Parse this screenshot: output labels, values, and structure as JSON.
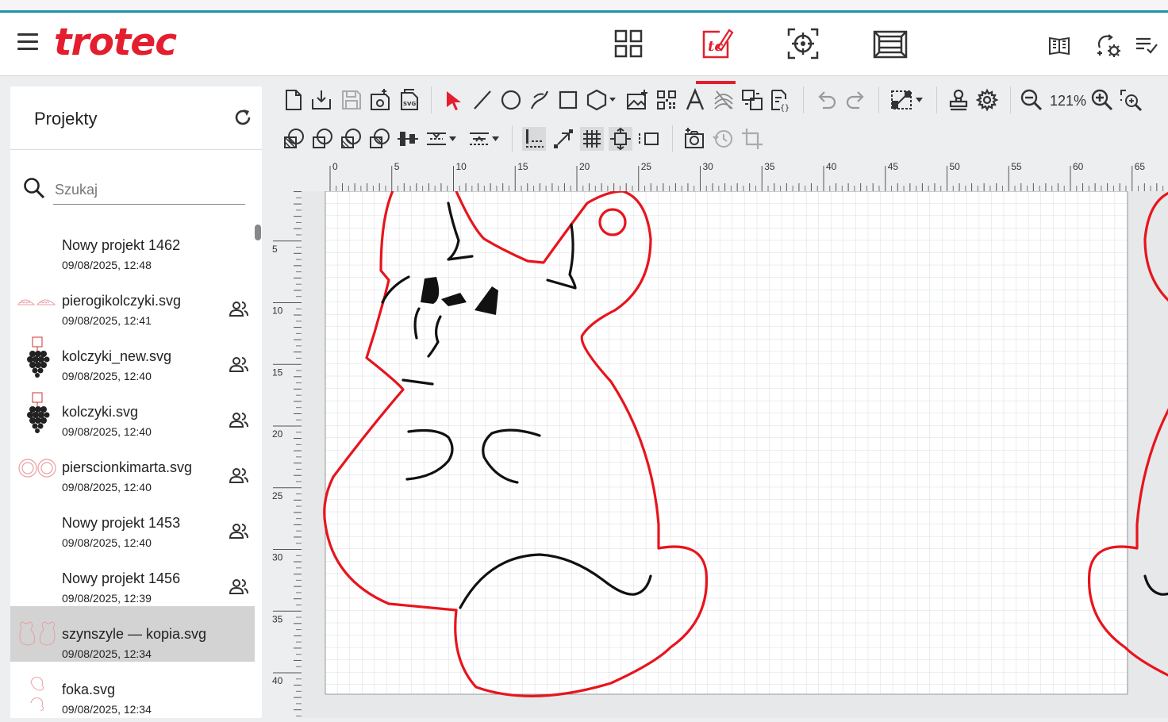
{
  "header": {
    "logo": "trotec",
    "nav": [
      {
        "name": "dashboard",
        "icon": "grid-icon"
      },
      {
        "name": "design",
        "icon": "design-pen-icon",
        "active": true
      },
      {
        "name": "prepare",
        "icon": "crosshair-icon"
      },
      {
        "name": "job",
        "icon": "machine-icon"
      }
    ],
    "right_icons": [
      "book-icon",
      "sync-settings-icon",
      "queue-list-icon"
    ]
  },
  "sidebar": {
    "title": "Projekty",
    "search_placeholder": "Szukaj",
    "projects": [
      {
        "name": "Nowy projekt 1462",
        "date": "09/08/2025, 12:48",
        "shared": false,
        "thumb": "none"
      },
      {
        "name": "pierogikolczyki.svg",
        "date": "09/08/2025, 12:41",
        "shared": true,
        "thumb": "pierogi"
      },
      {
        "name": "kolczyki_new.svg",
        "date": "09/08/2025, 12:40",
        "shared": true,
        "thumb": "grapes"
      },
      {
        "name": "kolczyki.svg",
        "date": "09/08/2025, 12:40",
        "shared": true,
        "thumb": "grapes"
      },
      {
        "name": "pierscionkimarta.svg",
        "date": "09/08/2025, 12:40",
        "shared": true,
        "thumb": "rings"
      },
      {
        "name": "Nowy projekt 1453",
        "date": "09/08/2025, 12:40",
        "shared": true,
        "thumb": "none"
      },
      {
        "name": "Nowy projekt 1456",
        "date": "09/08/2025, 12:39",
        "shared": true,
        "thumb": "none"
      },
      {
        "name": "szynszyle — kopia.svg",
        "date": "09/08/2025, 12:34",
        "shared": false,
        "thumb": "cats",
        "selected": true
      },
      {
        "name": "foka.svg",
        "date": "09/08/2025, 12:34",
        "shared": false,
        "thumb": "seal"
      }
    ]
  },
  "toolbar": {
    "zoom": "121%"
  },
  "ruler": {
    "h_labels": [
      "0",
      "5",
      "10",
      "15",
      "20",
      "25",
      "30",
      "35",
      "40",
      "45",
      "50",
      "55",
      "60",
      "65"
    ],
    "v_labels": [
      "5",
      "10",
      "15",
      "20",
      "25",
      "30",
      "35",
      "40"
    ]
  },
  "colors": {
    "brand": "#e41e2e",
    "cut": "#e8141c",
    "engrave": "#111111"
  }
}
